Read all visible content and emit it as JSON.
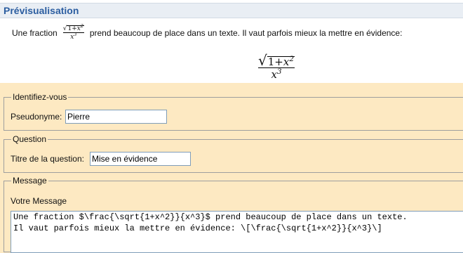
{
  "preview": {
    "title": "Prévisualisation",
    "text_before": "Une fraction",
    "text_after": "prend beaucoup de place dans un texte. Il vaut parfois mieux la mettre en évidence:",
    "formula": {
      "sqrt_one": "1",
      "plus": "+",
      "var": "x",
      "num_exp": "2",
      "den_exp": "3"
    }
  },
  "identity": {
    "legend": "Identifiez-vous",
    "pseudonym_label": "Pseudonyme:",
    "pseudonym_value": "Pierre"
  },
  "question": {
    "legend": "Question",
    "title_label": "Titre de la question:",
    "title_value": "Mise en évidence"
  },
  "message": {
    "legend": "Message",
    "label": "Votre Message",
    "value": "Une fraction $\\frac{\\sqrt{1+x^2}}{x^3}$ prend beaucoup de place dans un texte.\nIl vaut parfois mieux la mettre en évidence: \\[\\frac{\\sqrt{1+x^2}}{x^3}\\]"
  }
}
